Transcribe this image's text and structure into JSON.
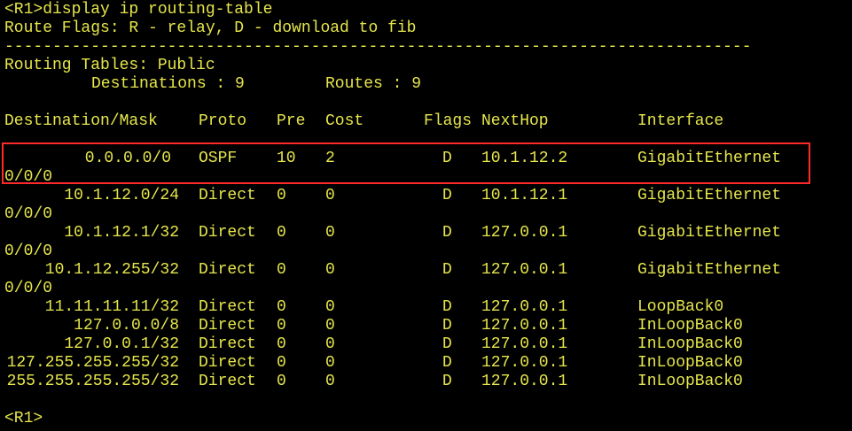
{
  "terminal": {
    "command_line": "<R1>display ip routing-table",
    "flags_line": "Route Flags: R - relay, D - download to fib",
    "separator": "------------------------------------------------------------------------------",
    "tables_title": "Routing Tables: Public",
    "summary": {
      "destinations_label": "Destinations : 9",
      "routes_label": "Routes : 9"
    },
    "headers": {
      "destination": "Destination/Mask",
      "proto": "Proto",
      "pre": "Pre",
      "cost": "Cost",
      "flags": "Flags",
      "nexthop": "NextHop",
      "interface": "Interface"
    },
    "routes": [
      {
        "destination": "0.0.0.0/0",
        "proto": "OSPF",
        "pre": "10",
        "cost": "2",
        "flags": "D",
        "nexthop": "10.1.12.2",
        "interface": "GigabitEthernet",
        "interface_cont": "0/0/0"
      },
      {
        "destination": "10.1.12.0/24",
        "proto": "Direct",
        "pre": "0",
        "cost": "0",
        "flags": "D",
        "nexthop": "10.1.12.1",
        "interface": "GigabitEthernet",
        "interface_cont": "0/0/0"
      },
      {
        "destination": "10.1.12.1/32",
        "proto": "Direct",
        "pre": "0",
        "cost": "0",
        "flags": "D",
        "nexthop": "127.0.0.1",
        "interface": "GigabitEthernet",
        "interface_cont": "0/0/0"
      },
      {
        "destination": "10.1.12.255/32",
        "proto": "Direct",
        "pre": "0",
        "cost": "0",
        "flags": "D",
        "nexthop": "127.0.0.1",
        "interface": "GigabitEthernet",
        "interface_cont": "0/0/0"
      },
      {
        "destination": "11.11.11.11/32",
        "proto": "Direct",
        "pre": "0",
        "cost": "0",
        "flags": "D",
        "nexthop": "127.0.0.1",
        "interface": "LoopBack0"
      },
      {
        "destination": "127.0.0.0/8",
        "proto": "Direct",
        "pre": "0",
        "cost": "0",
        "flags": "D",
        "nexthop": "127.0.0.1",
        "interface": "InLoopBack0"
      },
      {
        "destination": "127.0.0.1/32",
        "proto": "Direct",
        "pre": "0",
        "cost": "0",
        "flags": "D",
        "nexthop": "127.0.0.1",
        "interface": "InLoopBack0"
      },
      {
        "destination": "127.255.255.255/32",
        "proto": "Direct",
        "pre": "0",
        "cost": "0",
        "flags": "D",
        "nexthop": "127.0.0.1",
        "interface": "InLoopBack0"
      },
      {
        "destination": "255.255.255.255/32",
        "proto": "Direct",
        "pre": "0",
        "cost": "0",
        "flags": "D",
        "nexthop": "127.0.0.1",
        "interface": "InLoopBack0"
      }
    ],
    "prompt": "<R1>",
    "colors": {
      "background": "#000000",
      "text": "#e6e64c",
      "highlight_border": "#ff2a2a"
    }
  }
}
